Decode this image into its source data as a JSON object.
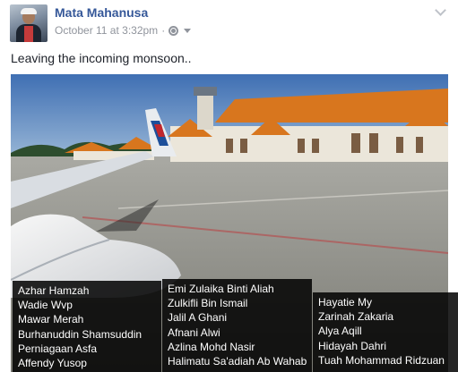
{
  "post": {
    "author": "Mata Mahanusa",
    "timestamp": "October 11 at 3:32pm",
    "separator": "·",
    "text": "Leaving the incoming monsoon..",
    "privacy_icon": "globe-icon",
    "options_icon": "chevron-down-icon"
  },
  "tag_list": {
    "col1": [
      "Azhar Hamzah",
      "Wadie Wvp",
      "Mawar Merah",
      "Burhanuddin Shamsuddin",
      "Perniagaan Asfa",
      "Affendy Yusop"
    ],
    "col2": [
      "Emi Zulaika Binti Aliah",
      "Zulkifli Bin Ismail",
      "Jalil A Ghani",
      "Afnani Alwi",
      "Azlina Mohd Nasir",
      "Halimatu Sa'adiah Ab Wahab"
    ],
    "col3": [
      "Hayatie My",
      "Zarinah Zakaria",
      "Alya Aqill",
      "Hidayah Dahri",
      "Tuah Mohammad Ridzuan"
    ]
  },
  "colors": {
    "link": "#365899",
    "meta": "#90949c",
    "text": "#1d2129",
    "overlay": "#000000"
  }
}
